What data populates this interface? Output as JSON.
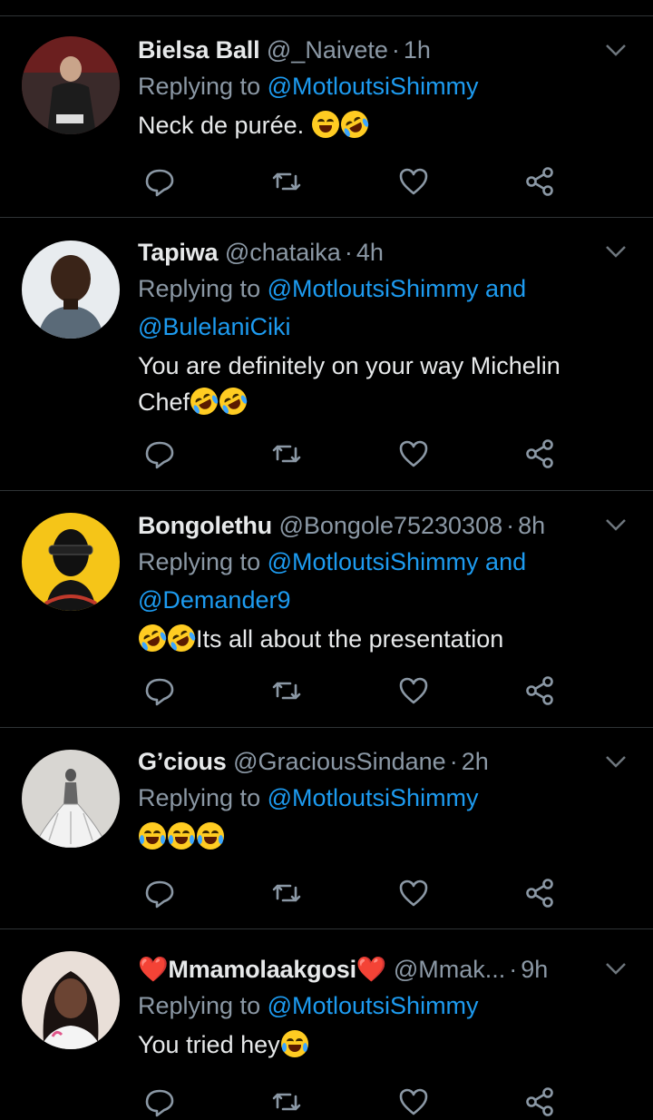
{
  "colors": {
    "background": "#000000",
    "text": "#e7e9ea",
    "muted": "#8b98a5",
    "link": "#1d9bf0",
    "divider": "#2f3336"
  },
  "icons": {
    "reply": "comment-icon",
    "retweet": "retweet-icon",
    "like": "heart-icon",
    "share": "share-icon",
    "more": "chevron-down-icon"
  },
  "tweets": [
    {
      "name": "Bielsa Ball",
      "handle": "@_Naivete",
      "time": "1h",
      "replying_prefix": "Replying to ",
      "mentions_line1": "@MotloutsiShimmy",
      "mentions_line2": "",
      "text": "Neck de purée.",
      "emojis_after": [
        "loudly-crying-face",
        "rolling-on-floor-laughing"
      ]
    },
    {
      "name": "Tapiwa",
      "handle": "@chataika",
      "time": "4h",
      "replying_prefix": "Replying to ",
      "mentions_line1": "@MotloutsiShimmy and",
      "mentions_line2": "@BulelaniCiki",
      "text_line1": "You are definitely on your way Michelin",
      "text_line2": "Chef",
      "emojis_after": [
        "rolling-on-floor-laughing",
        "rolling-on-floor-laughing"
      ]
    },
    {
      "name": "Bongolethu",
      "handle": "@Bongole75230308",
      "time": "8h",
      "replying_prefix": "Replying to ",
      "mentions_line1": "@MotloutsiShimmy and",
      "mentions_line2": "@Demander9",
      "emojis_before": [
        "rolling-on-floor-laughing",
        "rolling-on-floor-laughing"
      ],
      "text": "Its all about the presentation"
    },
    {
      "name": "G’cious",
      "handle": "@GraciousSindane",
      "time": "2h",
      "replying_prefix": "Replying to ",
      "mentions_line1": "@MotloutsiShimmy",
      "mentions_line2": "",
      "emojis_only": [
        "face-with-tears-of-joy",
        "face-with-tears-of-joy",
        "face-with-tears-of-joy"
      ]
    },
    {
      "name": "❤️Mmamolaakgosi❤️",
      "handle": "@Mmak...",
      "time": "9h",
      "replying_prefix": "Replying to ",
      "mentions_line1": "@MotloutsiShimmy",
      "mentions_line2": "",
      "text": "You tried hey",
      "emojis_after": [
        "face-with-tears-of-joy"
      ]
    }
  ]
}
